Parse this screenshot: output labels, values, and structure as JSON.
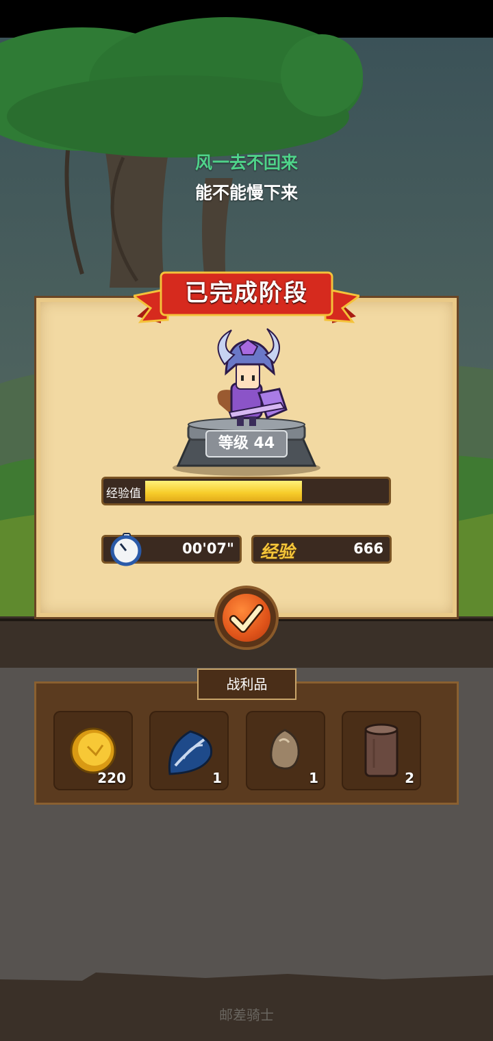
{
  "lyrics": {
    "line1": "风一去不回来",
    "line2": "能不能慢下来"
  },
  "result_panel": {
    "title": "已完成阶段",
    "level_label": "等级",
    "level_value": "44",
    "xp_bar_label": "经验值",
    "xp_progress_fraction": 0.65,
    "time_value": "00'07\"",
    "xp_reward_label": "经验",
    "xp_reward_value": "666"
  },
  "loot": {
    "title": "战利品",
    "items": [
      {
        "icon": "gold-coin-icon",
        "count": "220"
      },
      {
        "icon": "leaf-icon",
        "count": "1"
      },
      {
        "icon": "stone-icon",
        "count": "1"
      },
      {
        "icon": "wood-log-icon",
        "count": "2"
      }
    ]
  },
  "footer": {
    "text": "邮差骑士"
  },
  "colors": {
    "banner": "#d62a1e",
    "xp_fill": "#f7cc2a",
    "confirm": "#e0541a",
    "lyric_green": "#4fd38a"
  }
}
